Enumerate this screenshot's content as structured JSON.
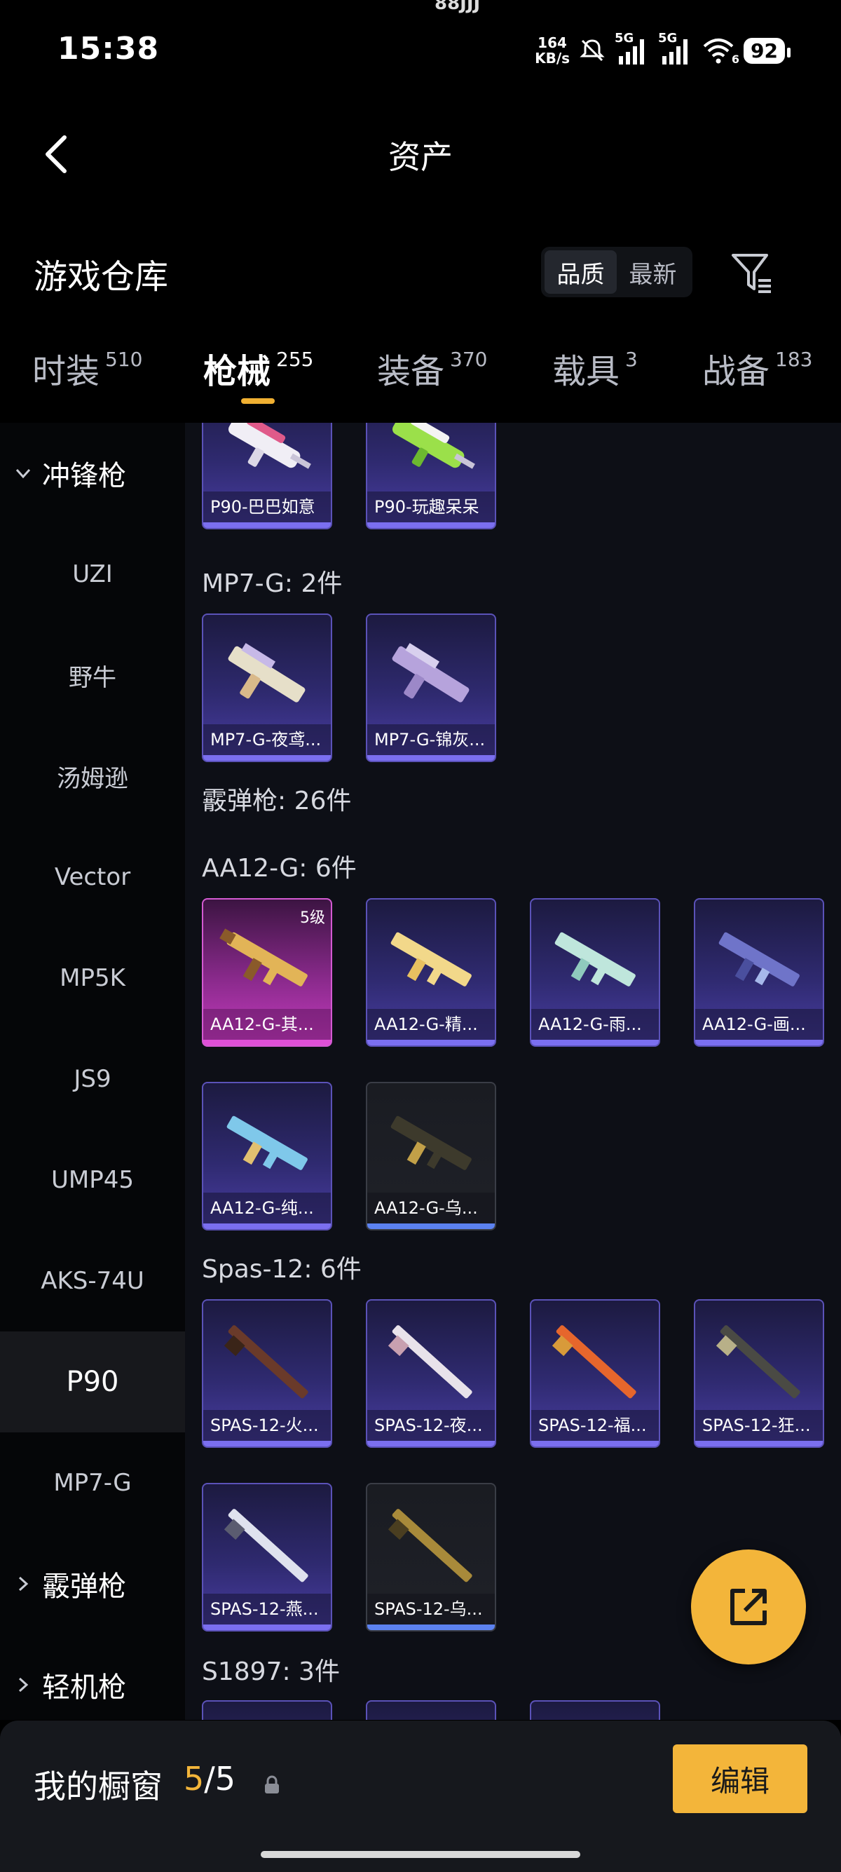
{
  "status_bar": {
    "time": "15:38",
    "net_speed_value": "164",
    "net_speed_unit": "KB/s",
    "sim1": "5G",
    "sim2": "5G",
    "wifi_sub": "6",
    "battery": "92",
    "notch_text": "88JJJ"
  },
  "header": {
    "title": "资产"
  },
  "warehouse": {
    "title": "游戏仓库",
    "sort_options": [
      "品质",
      "最新"
    ],
    "active_sort": "品质"
  },
  "tabs": [
    {
      "label": "时装",
      "count": "510"
    },
    {
      "label": "枪械",
      "count": "255"
    },
    {
      "label": "装备",
      "count": "370"
    },
    {
      "label": "载具",
      "count": "3"
    },
    {
      "label": "战备",
      "count": "183"
    }
  ],
  "active_tab": "枪械",
  "sidebar": {
    "group_open": "冲锋枪",
    "items": [
      "UZI",
      "野牛",
      "汤姆逊",
      "Vector",
      "MP5K",
      "JS9",
      "UMP45",
      "AKS-74U",
      "P90",
      "MP7-G"
    ],
    "active_item": "P90",
    "group_closed_1": "霰弹枪",
    "group_closed_2": "轻机枪"
  },
  "content": {
    "p90_items": [
      "P90-巴巴如意",
      "P90-玩趣呆呆"
    ],
    "mp7_label": "MP7-G: 2件",
    "mp7_items": [
      "MP7-G-夜鸢...",
      "MP7-G-锦灰..."
    ],
    "shotgun_label": "霰弹枪: 26件",
    "aa12_label": "AA12-G: 6件",
    "aa12_level": "5级",
    "aa12_items": [
      "AA12-G-其...",
      "AA12-G-精...",
      "AA12-G-雨...",
      "AA12-G-画...",
      "AA12-G-纯...",
      "AA12-G-乌..."
    ],
    "spas_label": "Spas-12: 6件",
    "spas_items": [
      "SPAS-12-火...",
      "SPAS-12-夜...",
      "SPAS-12-福...",
      "SPAS-12-狂...",
      "SPAS-12-燕...",
      "SPAS-12-乌..."
    ],
    "s1897_label": "S1897: 3件"
  },
  "showcase": {
    "label": "我的橱窗",
    "current": "5",
    "separator": "/",
    "total": "5",
    "edit_label": "编辑"
  },
  "colors": {
    "accent": "#f3b53a",
    "purple_card": "#4a3ea4",
    "pink_card": "#c63cbf",
    "dark_card": "#1f2128"
  }
}
